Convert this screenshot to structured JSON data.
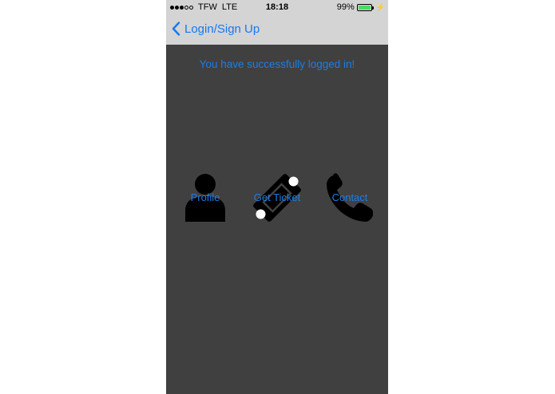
{
  "status_bar": {
    "signal_dots_filled": 3,
    "signal_dots_empty": 2,
    "carrier": "TFW",
    "network": "LTE",
    "time": "18:18",
    "battery_percent": "99%",
    "battery_level": 0.99,
    "battery_color": "#4cd964",
    "charging_icon": "bolt-icon"
  },
  "nav": {
    "back_icon": "chevron-left-icon",
    "back_label": "Login/Sign Up",
    "tint_color": "#1679f0"
  },
  "main": {
    "message": "You have successfully logged in!",
    "background_color": "#404040",
    "menu": [
      {
        "label": "Profile",
        "icon": "user-icon"
      },
      {
        "label": "Get Ticket",
        "icon": "ticket-icon"
      },
      {
        "label": "Contact",
        "icon": "phone-icon"
      }
    ]
  }
}
